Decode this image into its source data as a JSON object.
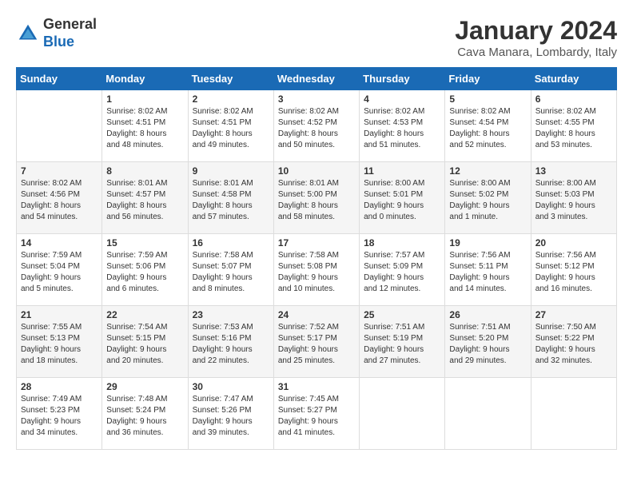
{
  "logo": {
    "general": "General",
    "blue": "Blue"
  },
  "header": {
    "month_year": "January 2024",
    "location": "Cava Manara, Lombardy, Italy"
  },
  "weekdays": [
    "Sunday",
    "Monday",
    "Tuesday",
    "Wednesday",
    "Thursday",
    "Friday",
    "Saturday"
  ],
  "weeks": [
    [
      {
        "day": "",
        "info": ""
      },
      {
        "day": "1",
        "info": "Sunrise: 8:02 AM\nSunset: 4:51 PM\nDaylight: 8 hours\nand 48 minutes."
      },
      {
        "day": "2",
        "info": "Sunrise: 8:02 AM\nSunset: 4:51 PM\nDaylight: 8 hours\nand 49 minutes."
      },
      {
        "day": "3",
        "info": "Sunrise: 8:02 AM\nSunset: 4:52 PM\nDaylight: 8 hours\nand 50 minutes."
      },
      {
        "day": "4",
        "info": "Sunrise: 8:02 AM\nSunset: 4:53 PM\nDaylight: 8 hours\nand 51 minutes."
      },
      {
        "day": "5",
        "info": "Sunrise: 8:02 AM\nSunset: 4:54 PM\nDaylight: 8 hours\nand 52 minutes."
      },
      {
        "day": "6",
        "info": "Sunrise: 8:02 AM\nSunset: 4:55 PM\nDaylight: 8 hours\nand 53 minutes."
      }
    ],
    [
      {
        "day": "7",
        "info": "Sunrise: 8:02 AM\nSunset: 4:56 PM\nDaylight: 8 hours\nand 54 minutes."
      },
      {
        "day": "8",
        "info": "Sunrise: 8:01 AM\nSunset: 4:57 PM\nDaylight: 8 hours\nand 56 minutes."
      },
      {
        "day": "9",
        "info": "Sunrise: 8:01 AM\nSunset: 4:58 PM\nDaylight: 8 hours\nand 57 minutes."
      },
      {
        "day": "10",
        "info": "Sunrise: 8:01 AM\nSunset: 5:00 PM\nDaylight: 8 hours\nand 58 minutes."
      },
      {
        "day": "11",
        "info": "Sunrise: 8:00 AM\nSunset: 5:01 PM\nDaylight: 9 hours\nand 0 minutes."
      },
      {
        "day": "12",
        "info": "Sunrise: 8:00 AM\nSunset: 5:02 PM\nDaylight: 9 hours\nand 1 minute."
      },
      {
        "day": "13",
        "info": "Sunrise: 8:00 AM\nSunset: 5:03 PM\nDaylight: 9 hours\nand 3 minutes."
      }
    ],
    [
      {
        "day": "14",
        "info": "Sunrise: 7:59 AM\nSunset: 5:04 PM\nDaylight: 9 hours\nand 5 minutes."
      },
      {
        "day": "15",
        "info": "Sunrise: 7:59 AM\nSunset: 5:06 PM\nDaylight: 9 hours\nand 6 minutes."
      },
      {
        "day": "16",
        "info": "Sunrise: 7:58 AM\nSunset: 5:07 PM\nDaylight: 9 hours\nand 8 minutes."
      },
      {
        "day": "17",
        "info": "Sunrise: 7:58 AM\nSunset: 5:08 PM\nDaylight: 9 hours\nand 10 minutes."
      },
      {
        "day": "18",
        "info": "Sunrise: 7:57 AM\nSunset: 5:09 PM\nDaylight: 9 hours\nand 12 minutes."
      },
      {
        "day": "19",
        "info": "Sunrise: 7:56 AM\nSunset: 5:11 PM\nDaylight: 9 hours\nand 14 minutes."
      },
      {
        "day": "20",
        "info": "Sunrise: 7:56 AM\nSunset: 5:12 PM\nDaylight: 9 hours\nand 16 minutes."
      }
    ],
    [
      {
        "day": "21",
        "info": "Sunrise: 7:55 AM\nSunset: 5:13 PM\nDaylight: 9 hours\nand 18 minutes."
      },
      {
        "day": "22",
        "info": "Sunrise: 7:54 AM\nSunset: 5:15 PM\nDaylight: 9 hours\nand 20 minutes."
      },
      {
        "day": "23",
        "info": "Sunrise: 7:53 AM\nSunset: 5:16 PM\nDaylight: 9 hours\nand 22 minutes."
      },
      {
        "day": "24",
        "info": "Sunrise: 7:52 AM\nSunset: 5:17 PM\nDaylight: 9 hours\nand 25 minutes."
      },
      {
        "day": "25",
        "info": "Sunrise: 7:51 AM\nSunset: 5:19 PM\nDaylight: 9 hours\nand 27 minutes."
      },
      {
        "day": "26",
        "info": "Sunrise: 7:51 AM\nSunset: 5:20 PM\nDaylight: 9 hours\nand 29 minutes."
      },
      {
        "day": "27",
        "info": "Sunrise: 7:50 AM\nSunset: 5:22 PM\nDaylight: 9 hours\nand 32 minutes."
      }
    ],
    [
      {
        "day": "28",
        "info": "Sunrise: 7:49 AM\nSunset: 5:23 PM\nDaylight: 9 hours\nand 34 minutes."
      },
      {
        "day": "29",
        "info": "Sunrise: 7:48 AM\nSunset: 5:24 PM\nDaylight: 9 hours\nand 36 minutes."
      },
      {
        "day": "30",
        "info": "Sunrise: 7:47 AM\nSunset: 5:26 PM\nDaylight: 9 hours\nand 39 minutes."
      },
      {
        "day": "31",
        "info": "Sunrise: 7:45 AM\nSunset: 5:27 PM\nDaylight: 9 hours\nand 41 minutes."
      },
      {
        "day": "",
        "info": ""
      },
      {
        "day": "",
        "info": ""
      },
      {
        "day": "",
        "info": ""
      }
    ]
  ]
}
